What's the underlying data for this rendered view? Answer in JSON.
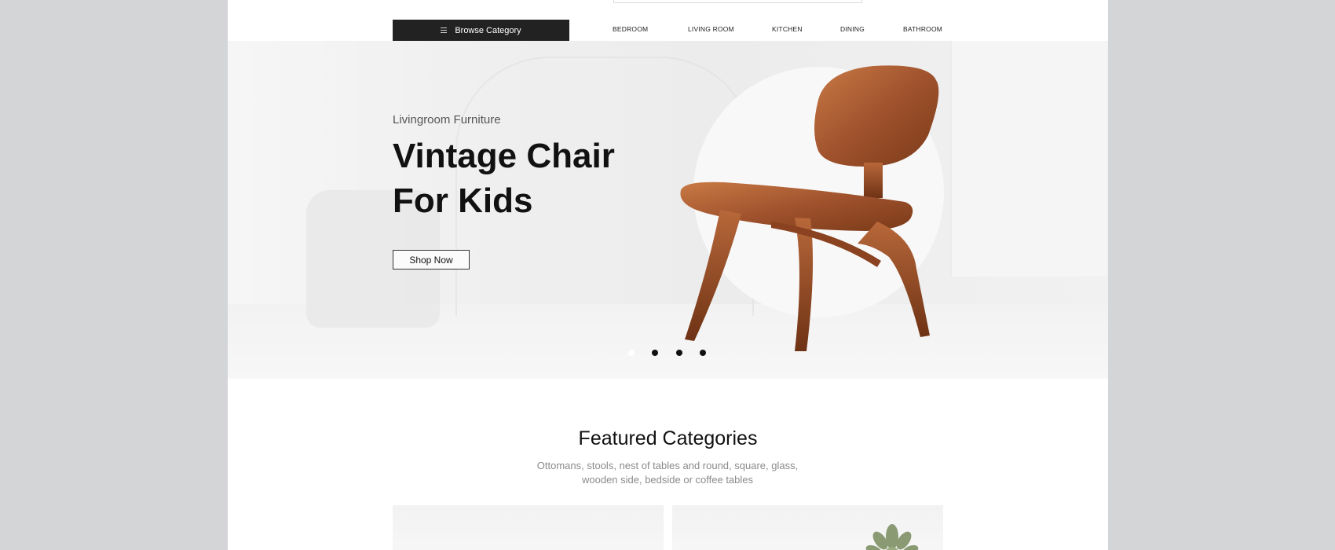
{
  "header": {
    "browse_label": "Browse Category",
    "nav": [
      "BEDROOM",
      "LIVING ROOM",
      "KITCHEN",
      "DINING",
      "BATHROOM"
    ]
  },
  "hero": {
    "subtitle": "Livingroom Furniture",
    "title": "Vintage Chair For Kids",
    "cta_label": "Shop Now",
    "slides_total": 4,
    "active_slide": 1
  },
  "featured": {
    "title": "Featured Categories",
    "description": "Ottomans, stools, nest of tables and round, square, glass, wooden side, bedside or coffee tables"
  },
  "icons": {
    "browse": "menu-icon",
    "hero_image": "wooden-chair-image",
    "card_image": "succulent-plant-image"
  },
  "colors": {
    "dark_button": "#222222",
    "text_primary": "#111111",
    "text_muted": "#8a8a8a",
    "wood": "#a0522d"
  }
}
